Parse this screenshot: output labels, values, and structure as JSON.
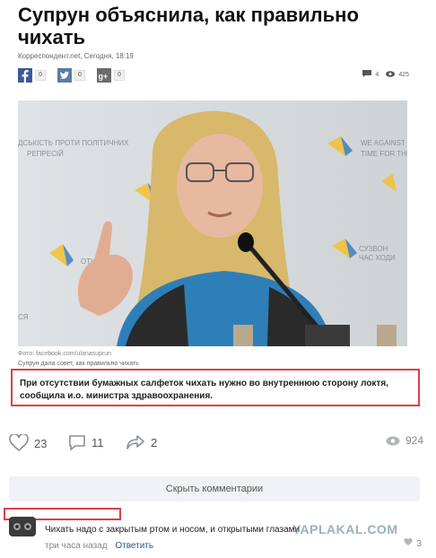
{
  "article": {
    "title": "Супрун объяснила, как правильно чихать",
    "meta": "Корреспондент.net, Сегодня, 18:19",
    "photo_credit": "Фото: facebook.com/ulanasuprun",
    "photo_caption": "Супрун дала совет, как правильно чихать",
    "quote": "При отсутствии бумажных салфеток чихать нужно во внутреннюю сторону локтя, сообщила и.о. министра здравоохранения."
  },
  "share": {
    "facebook": {
      "icon": "facebook-icon",
      "count": "0"
    },
    "twitter": {
      "icon": "twitter-icon",
      "count": "0"
    },
    "googleplus": {
      "icon": "googleplus-icon",
      "count": "0"
    },
    "comments_count": "4",
    "views_count": "425"
  },
  "post_actions": {
    "likes": "23",
    "comments": "11",
    "shares": "2",
    "views": "924"
  },
  "hide_comments_label": "Скрыть комментарии",
  "comment": {
    "text": "Чихать надо с закрытым ртом и носом, и открытыми глазами",
    "time": "три часа назад",
    "reply": "Ответить",
    "likes": "3"
  },
  "watermark": "YAPLAKAL.COM",
  "colors": {
    "highlight_border": "#d9414b",
    "facebook": "#3b5998",
    "twitter": "#1da1f2",
    "googleplus": "#dd4b39",
    "link": "#2a5885"
  }
}
